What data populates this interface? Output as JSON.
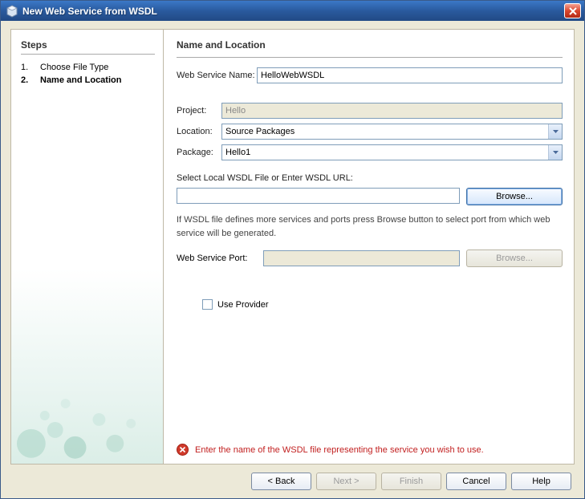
{
  "window": {
    "title": "New Web Service from WSDL"
  },
  "steps": {
    "heading": "Steps",
    "items": [
      {
        "num": "1.",
        "label": "Choose File Type",
        "active": false
      },
      {
        "num": "2.",
        "label": "Name and Location",
        "active": true
      }
    ]
  },
  "main": {
    "heading": "Name and Location",
    "webServiceName": {
      "label": "Web Service Name:",
      "value": "HelloWebWSDL"
    },
    "project": {
      "label": "Project:",
      "value": "Hello"
    },
    "location": {
      "label": "Location:",
      "value": "Source Packages"
    },
    "package": {
      "label": "Package:",
      "value": "Hello1"
    },
    "wsdlSection": {
      "label": "Select Local WSDL File or Enter WSDL URL:",
      "value": "",
      "browse": "Browse..."
    },
    "hint": "If WSDL file defines more services and ports press Browse button to select port from which web service will be generated.",
    "port": {
      "label": "Web Service Port:",
      "value": "",
      "browse": "Browse..."
    },
    "provider": {
      "label": "Use Provider",
      "checked": false
    },
    "error": {
      "text": "Enter the name of the WSDL file representing the service you wish to use."
    }
  },
  "buttons": {
    "back": "< Back",
    "next": "Next >",
    "finish": "Finish",
    "cancel": "Cancel",
    "help": "Help"
  }
}
